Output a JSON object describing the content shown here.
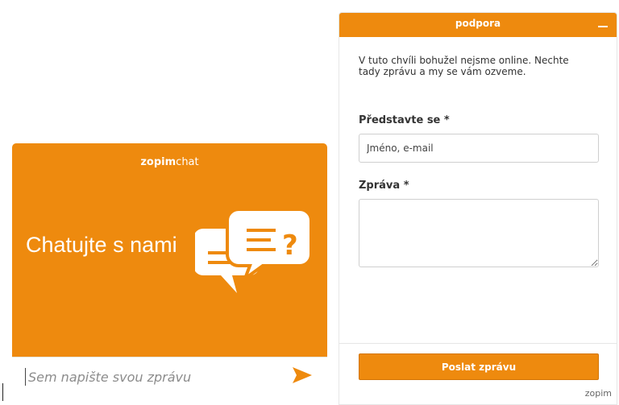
{
  "left_widget": {
    "brand_bold": "zopim",
    "brand_thin": "chat",
    "headline": "Chatujte s nami",
    "input_placeholder": "Sem napište svou zprávu",
    "send_icon": "send-arrow-icon",
    "bubbles_icon": "chat-bubbles-icon"
  },
  "right_panel": {
    "title": "podpora",
    "minimize_icon": "minimize-icon",
    "offline_message": "V tuto chvíli bohužel nejsme online. Nechte tady zprávu a my se vám ozveme.",
    "name_label": "Představte se *",
    "name_placeholder": "Jméno, e-mail",
    "message_label": "Zpráva *",
    "send_button": "Poslat zprávu",
    "footer_brand": "zopim"
  },
  "colors": {
    "accent": "#ee8a0e",
    "accent_border": "#d27508"
  }
}
